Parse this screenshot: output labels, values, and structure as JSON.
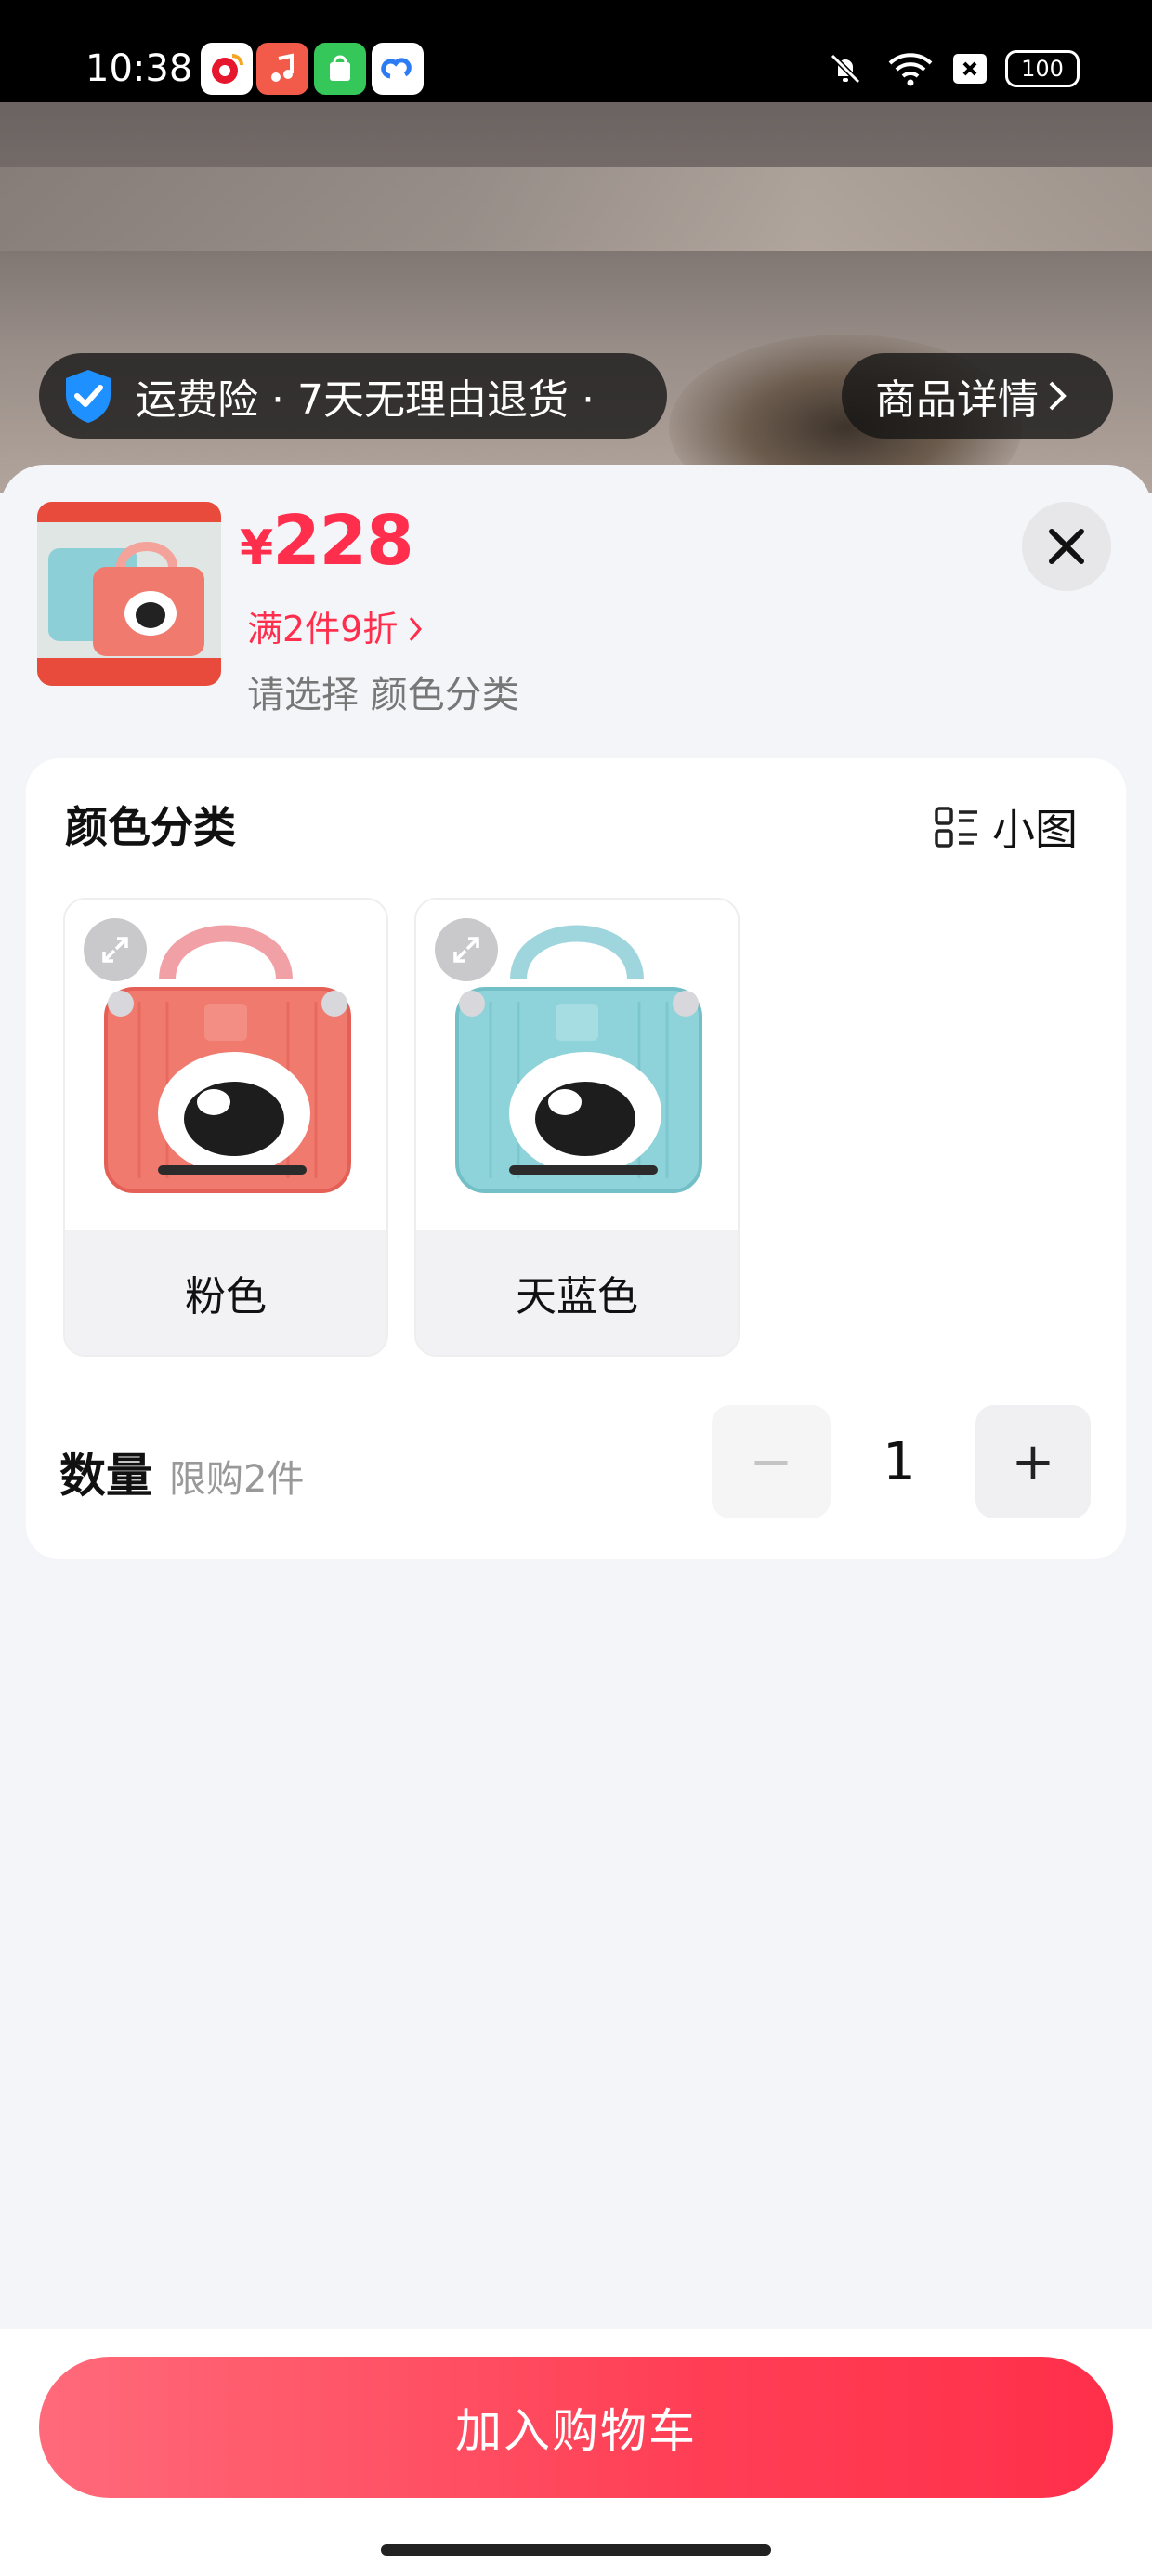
{
  "status_bar": {
    "time": "10:38",
    "battery": "100",
    "apps": [
      "weibo-icon",
      "music-icon",
      "store-icon",
      "cloud-icon"
    ]
  },
  "hero": {
    "service_text": "运费险 · 7天无理由退货 ·",
    "details_link": "商品详情"
  },
  "product": {
    "price_symbol": "¥",
    "price": "228",
    "promo": "满2件9折",
    "select_hint": "请选择 颜色分类"
  },
  "options": {
    "title": "颜色分类",
    "view_label": "小图",
    "items": [
      {
        "label": "粉色",
        "color": "#f07a6e"
      },
      {
        "label": "天蓝色",
        "color": "#8fd3da"
      }
    ]
  },
  "quantity": {
    "title": "数量",
    "limit": "限购2件",
    "value": "1",
    "minus": "−",
    "plus": "+"
  },
  "footer": {
    "add_to_cart": "加入购物车"
  },
  "colors": {
    "accent": "#ff2e4d",
    "shield": "#1e90ff"
  }
}
